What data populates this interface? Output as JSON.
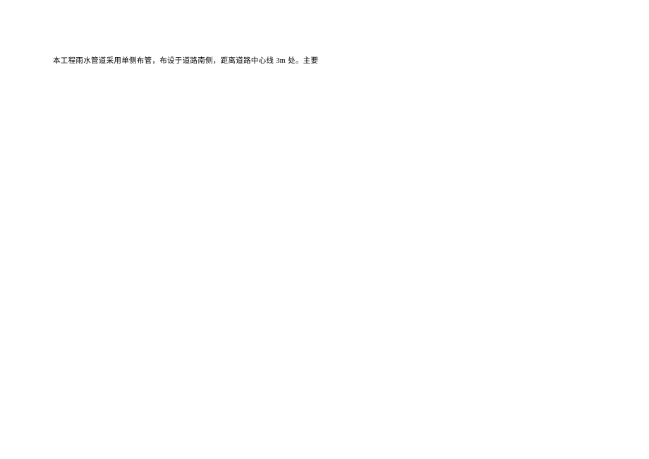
{
  "document": {
    "paragraph": "本工程雨水管道采用单侧布管，布设于道路南侧，距离道路中心线 3m 处。主要"
  }
}
